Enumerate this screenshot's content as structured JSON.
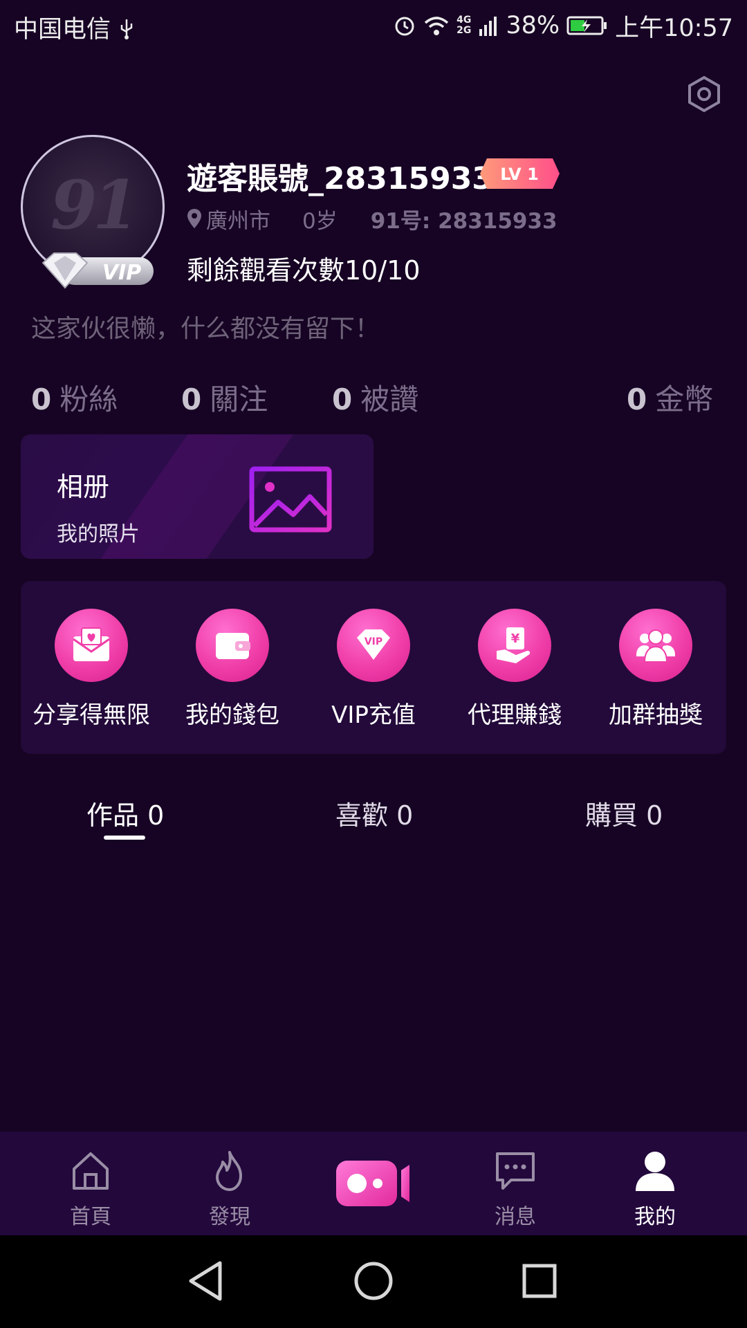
{
  "status_bar": {
    "carrier": "中国电信",
    "battery": "38%",
    "time": "上午10:57",
    "icons": [
      "usb-icon",
      "alarm-icon",
      "wifi-icon",
      "signal-icon",
      "battery-icon"
    ]
  },
  "profile": {
    "username": "遊客賬號_28315933",
    "level": "LV 1",
    "vip_label": "VIP",
    "location": "廣州市",
    "age": "0岁",
    "id_text": "91号: 28315933",
    "views_left": "剩餘觀看次數10/10",
    "bio": "这家伙很懒，什么都没有留下！"
  },
  "stats": [
    {
      "value": "0",
      "label": "粉絲"
    },
    {
      "value": "0",
      "label": "關注"
    },
    {
      "value": "0",
      "label": "被讚"
    },
    {
      "value": "0",
      "label": "金幣"
    }
  ],
  "album": {
    "title": "相册",
    "subtitle": "我的照片"
  },
  "features": [
    {
      "label": "分享得無限",
      "icon": "share-envelope-icon"
    },
    {
      "label": "我的錢包",
      "icon": "wallet-icon"
    },
    {
      "label": "VIP充值",
      "icon": "vip-diamond-icon"
    },
    {
      "label": "代理賺錢",
      "icon": "money-hand-icon"
    },
    {
      "label": "加群抽獎",
      "icon": "group-icon"
    }
  ],
  "tabs": [
    {
      "label": "作品 0",
      "active": true
    },
    {
      "label": "喜歡 0",
      "active": false
    },
    {
      "label": "購買 0",
      "active": false
    }
  ],
  "bottom_nav": [
    {
      "label": "首頁",
      "icon": "home-icon",
      "active": false
    },
    {
      "label": "發現",
      "icon": "flame-icon",
      "active": false
    },
    {
      "label": "",
      "icon": "video-record-icon",
      "active": false
    },
    {
      "label": "消息",
      "icon": "message-icon",
      "active": false
    },
    {
      "label": "我的",
      "icon": "profile-icon",
      "active": true
    }
  ],
  "colors": {
    "background": "#170424",
    "accent_pink": "#f03ea8",
    "panel": "#230a3a",
    "nav_bg": "#23083c"
  }
}
